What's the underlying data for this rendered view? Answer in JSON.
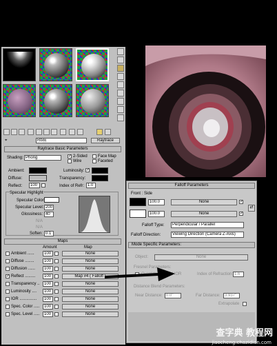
{
  "editor": {
    "material_name": "Rb前",
    "material_type": "Raytrace",
    "basic_params_title": "Raytrace Basic Parameters",
    "shading_label": "Shading:",
    "shading_value": "Phong",
    "two_sided": "2-Sided",
    "wire": "Wire",
    "face_map": "Face Map",
    "faceted": "Faceted",
    "ambient_label": "Ambient:",
    "diffuse_label": "Diffuse:",
    "reflect_label": "Reflect:",
    "reflect_value": "100",
    "luminosity_label": "Luminosity:",
    "transparency_label": "Transparency:",
    "ior_label": "Index of Refr:",
    "ior_value": "1.0",
    "specular_highlight_title": "Specular Highlight",
    "specular_color_label": "Specular Color:",
    "specular_level_label": "Specular Level:",
    "specular_level_value": "200",
    "glossiness_label": "Glossiness:",
    "glossiness_value": "40",
    "na_1": "N/A",
    "na_2": "N/A",
    "soften_label": "Soften:",
    "soften_value": "0.1",
    "colors": {
      "ambient": "#000000",
      "diffuse": "#bcbcbc",
      "specular": "#ffffff"
    },
    "maps": {
      "title": "Maps",
      "col_amount": "Amount",
      "col_map": "Map",
      "rows": [
        {
          "label": "Ambient ......",
          "amount": "100",
          "map": "None",
          "checked": false
        },
        {
          "label": "Diffuse ........",
          "amount": "100",
          "map": "None",
          "checked": false
        },
        {
          "label": "Diffusion ......",
          "amount": "100",
          "map": "None",
          "checked": false
        },
        {
          "label": "Reflect .........",
          "amount": "100",
          "map": "Map #4  ( Falloff )",
          "checked": true
        },
        {
          "label": "Transparency ..",
          "amount": "100",
          "map": "None",
          "checked": false
        },
        {
          "label": "Luminosity ....",
          "amount": "100",
          "map": "None",
          "checked": false
        },
        {
          "label": "IOR ...............",
          "amount": "100",
          "map": "None",
          "checked": false
        },
        {
          "label": "Spec. Color .....",
          "amount": "100",
          "map": "None",
          "checked": false
        },
        {
          "label": "Spec. Level .....",
          "amount": "100",
          "map": "None",
          "checked": false
        }
      ]
    }
  },
  "falloff": {
    "title": "Falloff Parameters",
    "front_side": "Front : Side",
    "front_amount": "100.0",
    "front_map": "None",
    "side_amount": "100.0",
    "side_map": "None",
    "falloff_type_label": "Falloff Type:",
    "falloff_type_value": "Perpendicular / Parallel",
    "falloff_direction_label": "Falloff Direction:",
    "falloff_direction_value": "Viewing Direction (Camera Z-Axis)",
    "mode_specific_title": "Mode Specific Parameters:",
    "object_label": "Object:",
    "object_value": "None",
    "fresnel_title": "Fresnel Parameters:",
    "override_ior": "Override Material IOR",
    "index_of_refraction_label": "Index of Refraction:",
    "index_of_refraction_value": "1.6",
    "distance_blend_title": "Distance Blend Parameters:",
    "near_label": "Near Distance:",
    "near_value": "0.0\"",
    "far_label": "Far Distance:",
    "far_value": "3.937\"",
    "extrapolate": "Extrapolate",
    "colors": {
      "front": "#000000",
      "side": "#ffffff"
    }
  },
  "watermark": {
    "top": "查字典 教程网",
    "bottom": "jiaocheng.chazidian.com"
  }
}
